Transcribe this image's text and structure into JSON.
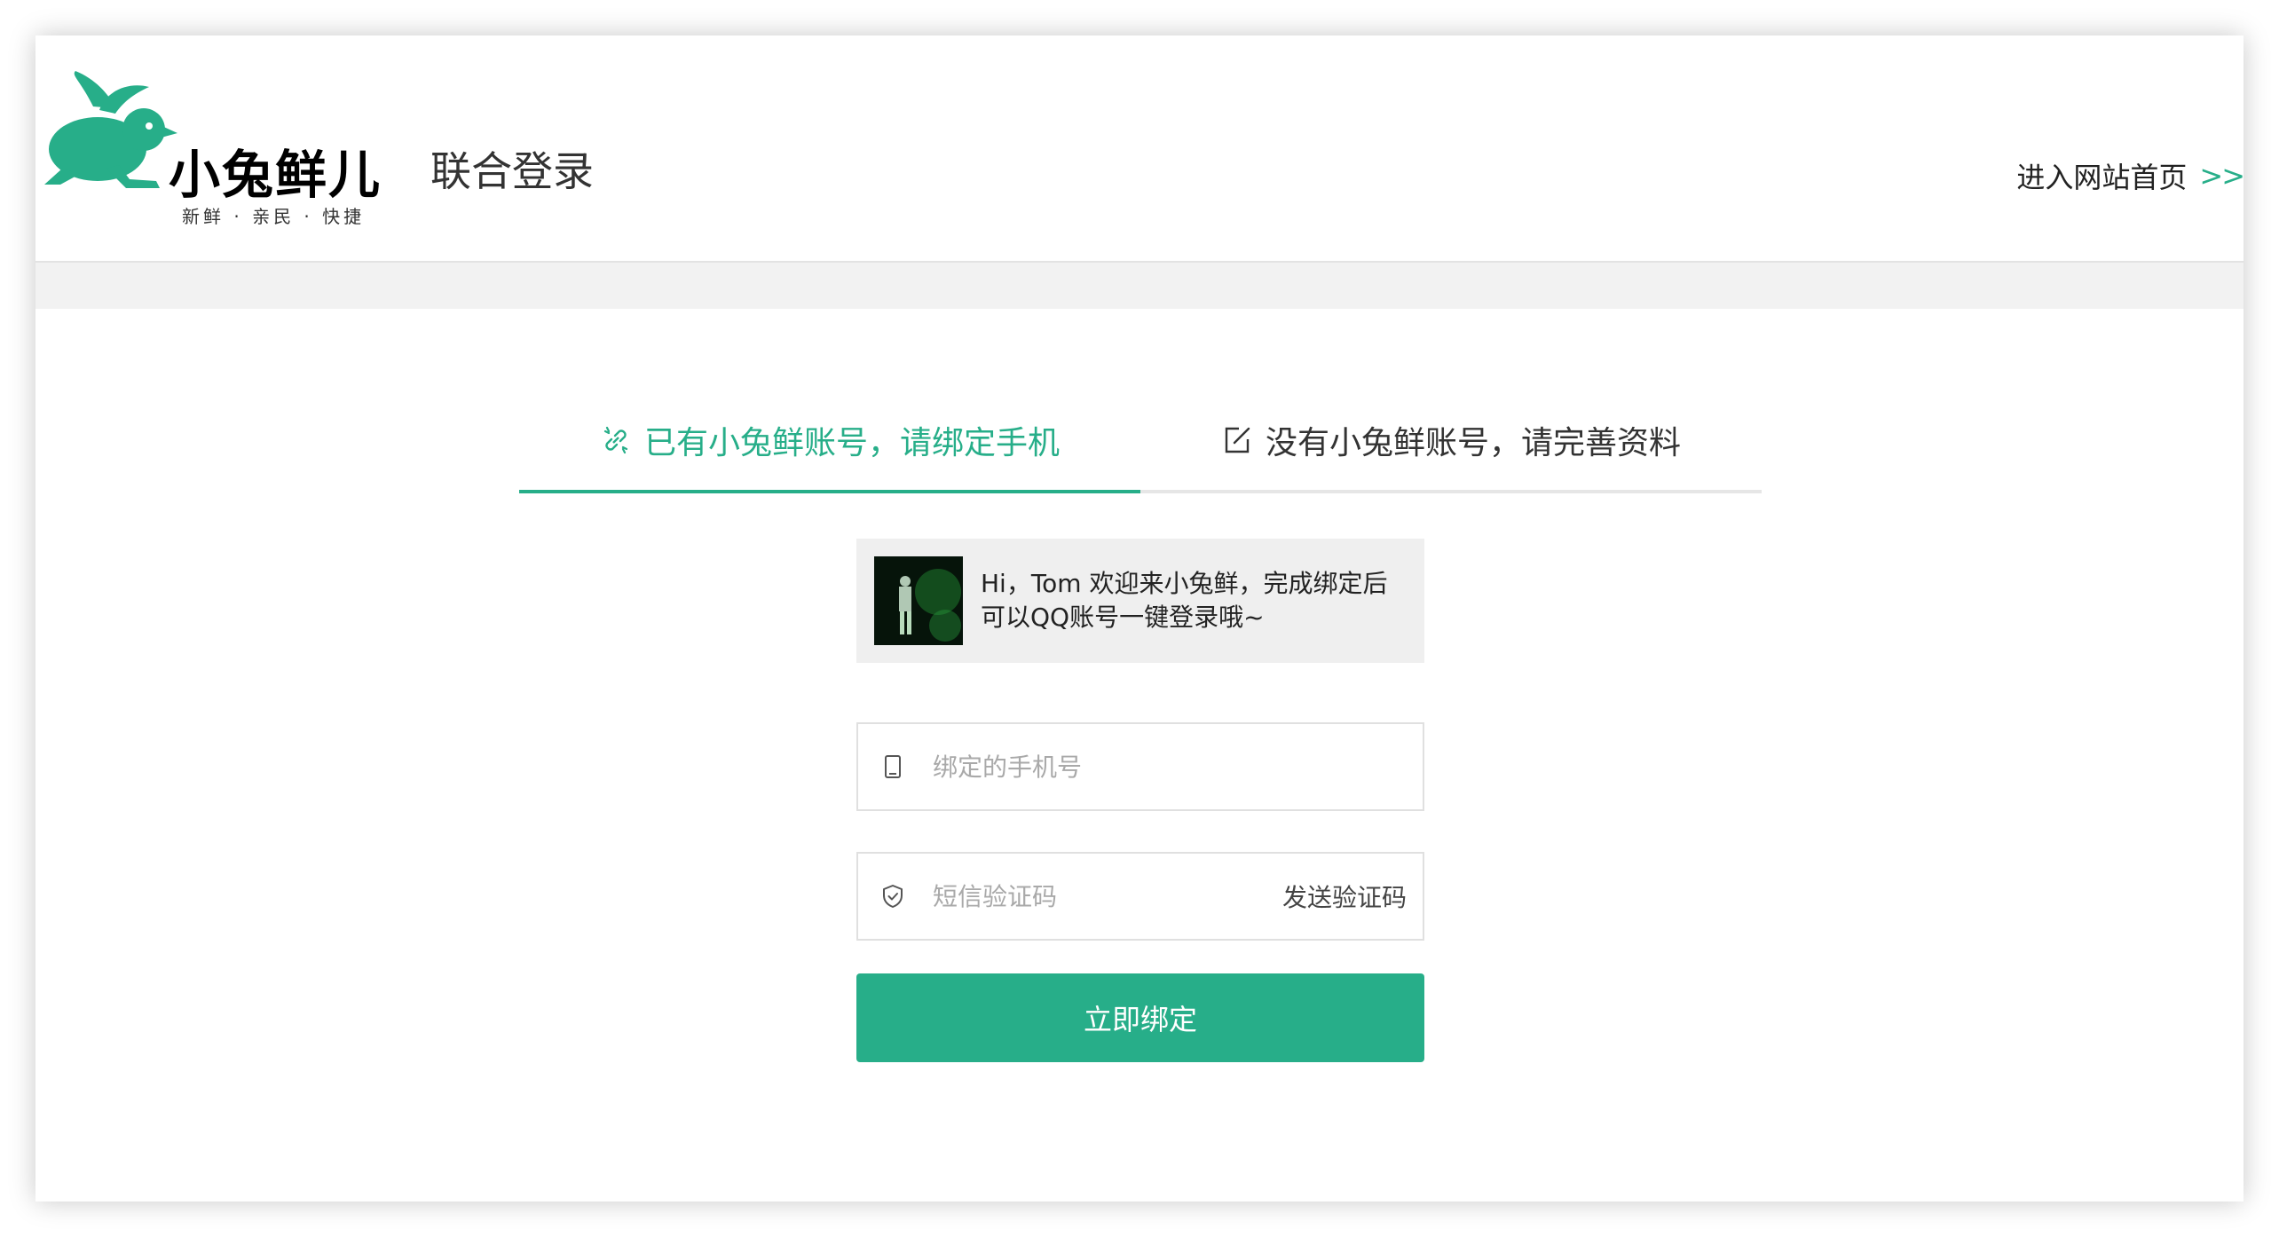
{
  "brand": {
    "name": "小兔鲜儿",
    "slogan": "新鲜 · 亲民 · 快捷",
    "color": "#27ae89"
  },
  "header": {
    "page_title": "联合登录",
    "home_link": "进入网站首页",
    "home_link_arrow": ">>"
  },
  "tabs": [
    {
      "label": "已有小兔鲜账号，请绑定手机",
      "icon": "link-icon",
      "active": true
    },
    {
      "label": "没有小兔鲜账号，请完善资料",
      "icon": "edit-icon",
      "active": false
    }
  ],
  "welcome": {
    "line1": "Hi，Tom 欢迎来小兔鲜，完成绑定后",
    "line2": "可以QQ账号一键登录哦~"
  },
  "form": {
    "phone_placeholder": "绑定的手机号",
    "code_placeholder": "短信验证码",
    "send_code_label": "发送验证码",
    "submit_label": "立即绑定"
  }
}
